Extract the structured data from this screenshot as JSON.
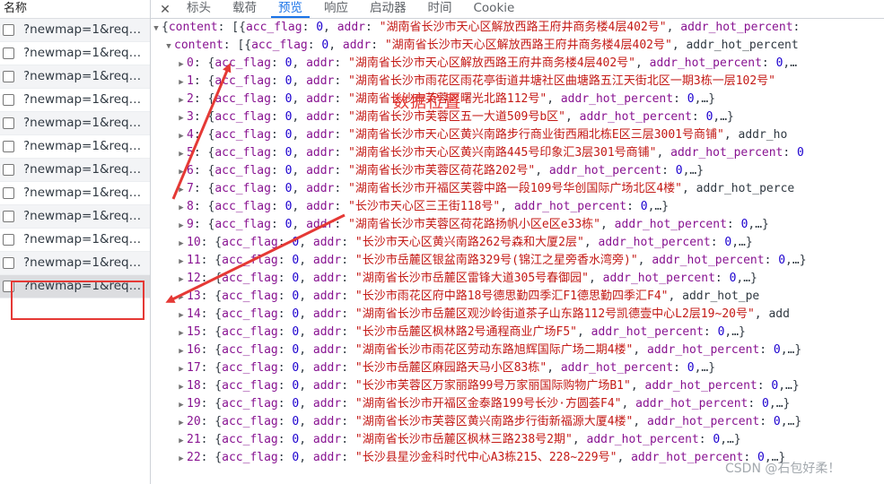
{
  "left_panel": {
    "header": "名称",
    "requests": [
      "?newmap=1&reqfl...",
      "?newmap=1&reqfl...",
      "?newmap=1&reqfl...",
      "?newmap=1&reqfl...",
      "?newmap=1&reqfl...",
      "?newmap=1&reqfl...",
      "?newmap=1&reqfl...",
      "?newmap=1&reqfl...",
      "?newmap=1&reqfl...",
      "?newmap=1&reqfl...",
      "?newmap=1&reqfl...",
      "?newmap=1&reqfl..."
    ],
    "selected_index": 11
  },
  "tabs": {
    "close_glyph": "✕",
    "items": [
      "标头",
      "载荷",
      "预览",
      "响应",
      "启动器",
      "时间",
      "Cookie"
    ],
    "active": "预览"
  },
  "preview": {
    "root_line": "{content: [{acc_flag: 0, addr: \"湖南省长沙市天心区解放西路王府井商务楼4层402号\", addr_hot_percent:",
    "content_line": "content: [{acc_flag: 0, addr: \"湖南省长沙市天心区解放西路王府井商务楼4层402号\", addr_hot_percent",
    "rows": [
      {
        "idx": "0",
        "addr": "湖南省长沙市天心区解放西路王府井商务楼4层402号",
        "tail": ", addr_hot_percent: 0,…"
      },
      {
        "idx": "1",
        "addr": "湖南省长沙市雨花区雨花亭街道井塘社区曲塘路五江天街北区一期3栋一层102号",
        "tail": ""
      },
      {
        "idx": "2",
        "addr": "湖南省长沙市芙蓉区曙光北路112号",
        "tail": ", addr_hot_percent: 0,…}"
      },
      {
        "idx": "3",
        "addr": "湖南省长沙市芙蓉区五一大道509号b区",
        "tail": ", addr_hot_percent: 0,…}"
      },
      {
        "idx": "4",
        "addr": "湖南省长沙市天心区黄兴南路步行商业街西厢北栋E区三层3001号商铺",
        "tail": ", addr_ho"
      },
      {
        "idx": "5",
        "addr": "湖南省长沙市天心区黄兴南路445号印象汇3层301号商铺",
        "tail": ", addr_hot_percent: 0"
      },
      {
        "idx": "6",
        "addr": "湖南省长沙市芙蓉区荷花路202号",
        "tail": ", addr_hot_percent: 0,…}"
      },
      {
        "idx": "7",
        "addr": "湖南省长沙市开福区芙蓉中路一段109号华创国际广场北区4楼",
        "tail": ", addr_hot_perce"
      },
      {
        "idx": "8",
        "addr": "长沙市天心区三王街118号",
        "tail": ", addr_hot_percent: 0,…}"
      },
      {
        "idx": "9",
        "addr": "湖南省长沙市芙蓉区荷花路扬帆小区e区e33栋",
        "tail": ", addr_hot_percent: 0,…}"
      },
      {
        "idx": "10",
        "addr": "长沙市天心区黄兴南路262号森和大厦2层",
        "tail": ", addr_hot_percent: 0,…}"
      },
      {
        "idx": "11",
        "addr": "长沙市岳麓区银盆南路329号(锦江之星旁香水湾旁)",
        "tail": ", addr_hot_percent: 0,…}"
      },
      {
        "idx": "12",
        "addr": "湖南省长沙市岳麓区雷锋大道305号春御园",
        "tail": ", addr_hot_percent: 0,…}"
      },
      {
        "idx": "13",
        "addr": "长沙市雨花区府中路18号德思勤四季汇F1德思勤四季汇F4",
        "tail": ", addr_hot_pe"
      },
      {
        "idx": "14",
        "addr": "湖南省长沙市岳麓区观沙岭街道茶子山东路112号凯德壹中心L2层19~20号",
        "tail": ", add"
      },
      {
        "idx": "15",
        "addr": "长沙市岳麓区枫林路2号通程商业广场F5",
        "tail": ", addr_hot_percent: 0,…}"
      },
      {
        "idx": "16",
        "addr": "湖南省长沙市雨花区劳动东路旭辉国际广场二期4楼",
        "tail": ", addr_hot_percent: 0,…}"
      },
      {
        "idx": "17",
        "addr": "长沙市岳麓区麻园路天马小区83栋",
        "tail": ", addr_hot_percent: 0,…}"
      },
      {
        "idx": "18",
        "addr": "长沙市芙蓉区万家丽路99号万家丽国际购物广场B1",
        "tail": ", addr_hot_percent: 0,…}"
      },
      {
        "idx": "19",
        "addr": "湖南省长沙市开福区金泰路199号长沙·方圆荟F4",
        "tail": ", addr_hot_percent: 0,…}"
      },
      {
        "idx": "20",
        "addr": "湖南省长沙市芙蓉区黄兴南路步行街新福源大厦4楼",
        "tail": ", addr_hot_percent: 0,…}"
      },
      {
        "idx": "21",
        "addr": "湖南省长沙市岳麓区枫林三路238号2期",
        "tail": ", addr_hot_percent: 0,…}"
      },
      {
        "idx": "22",
        "addr": "长沙县星沙金科时代中心A3栋215、228~229号",
        "tail": ", addr_hot_percent: 0,…}"
      }
    ]
  },
  "annotation": "数据位置",
  "watermark": "CSDN @石包好柔！",
  "colors": {
    "annotation_red": "#e53935",
    "active_tab": "#1a73e8"
  }
}
